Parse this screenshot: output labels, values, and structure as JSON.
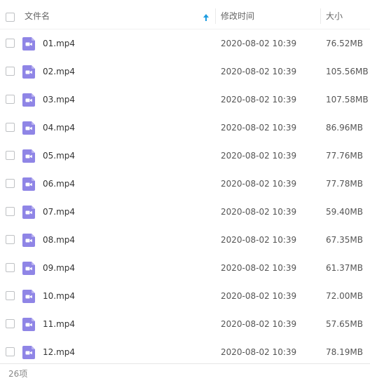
{
  "header": {
    "name_label": "文件名",
    "time_label": "修改时间",
    "size_label": "大小",
    "sort_icon": "arrow-up-icon"
  },
  "accent_color": "#1d9ce0",
  "file_icon": "video-file-icon",
  "file_icon_color": "#8f85e6",
  "files": [
    {
      "name": "01.mp4",
      "time": "2020-08-02 10:39",
      "size": "76.52MB"
    },
    {
      "name": "02.mp4",
      "time": "2020-08-02 10:39",
      "size": "105.56MB"
    },
    {
      "name": "03.mp4",
      "time": "2020-08-02 10:39",
      "size": "107.58MB"
    },
    {
      "name": "04.mp4",
      "time": "2020-08-02 10:39",
      "size": "86.96MB"
    },
    {
      "name": "05.mp4",
      "time": "2020-08-02 10:39",
      "size": "77.76MB"
    },
    {
      "name": "06.mp4",
      "time": "2020-08-02 10:39",
      "size": "77.78MB"
    },
    {
      "name": "07.mp4",
      "time": "2020-08-02 10:39",
      "size": "59.40MB"
    },
    {
      "name": "08.mp4",
      "time": "2020-08-02 10:39",
      "size": "67.35MB"
    },
    {
      "name": "09.mp4",
      "time": "2020-08-02 10:39",
      "size": "61.37MB"
    },
    {
      "name": "10.mp4",
      "time": "2020-08-02 10:39",
      "size": "72.00MB"
    },
    {
      "name": "11.mp4",
      "time": "2020-08-02 10:39",
      "size": "57.65MB"
    },
    {
      "name": "12.mp4",
      "time": "2020-08-02 10:39",
      "size": "78.19MB"
    }
  ],
  "footer": {
    "count_label": "26项"
  }
}
